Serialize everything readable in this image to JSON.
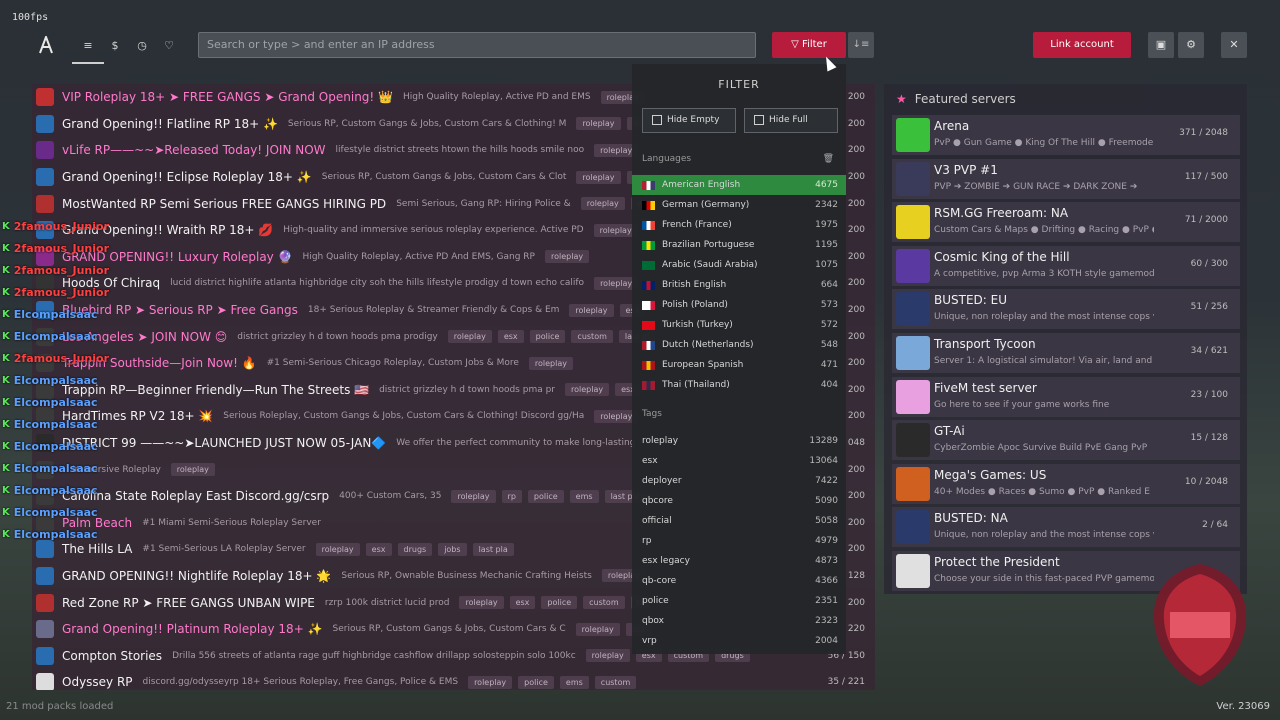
{
  "fps": "100fps",
  "topbar": {
    "search_placeholder": "Search or type > and enter an IP address",
    "filter_label": "Filter",
    "link_account_label": "Link account"
  },
  "servers": [
    {
      "name": "VIP Roleplay 18+ ➤ FREE GANGS ➤ Grand Opening! 👑",
      "pink": true,
      "desc": "High Quality Roleplay, Active PD and EMS",
      "tags": [
        "roleplay"
      ],
      "players": "200",
      "color": "#c03030"
    },
    {
      "name": "Grand Opening!! Flatline RP 18+ ✨",
      "pink": false,
      "desc": "Serious RP, Custom Gangs & Jobs, Custom Cars & Clothing! M",
      "tags": [
        "roleplay",
        "drugs"
      ],
      "players": "200",
      "color": "#2a6cb0"
    },
    {
      "name": "vLife RP——~~➤Released Today! JOIN NOW",
      "pink": true,
      "desc": "lifestyle district streets htown the hills hoods smile noo",
      "tags": [
        "roleplay"
      ],
      "players": "200",
      "color": "#6a2a8a"
    },
    {
      "name": "Grand Opening!! Eclipse Roleplay 18+ ✨",
      "pink": false,
      "desc": "Serious RP, Custom Gangs & Jobs, Custom Cars & Clot",
      "tags": [
        "roleplay",
        "drugs"
      ],
      "players": "200",
      "color": "#2a6cb0"
    },
    {
      "name": "MostWanted RP Semi Serious FREE GANGS HIRING PD",
      "pink": false,
      "desc": "Semi Serious, Gang RP: Hiring Police &",
      "tags": [
        "roleplay",
        "esx"
      ],
      "players": "200",
      "color": "#b03030"
    },
    {
      "name": "Grand Opening!! Wraith RP 18+ 💋",
      "pink": false,
      "desc": "High-quality and immersive serious roleplay experience. Active PD",
      "tags": [
        "roleplay"
      ],
      "players": "200",
      "color": "#2a6cb0"
    },
    {
      "name": "GRAND OPENING!! Luxury Roleplay 🔮",
      "pink": true,
      "desc": "High Quality Roleplay, Active PD And EMS, Gang RP",
      "tags": [
        "roleplay"
      ],
      "players": "200",
      "color": "#8a2a8a"
    },
    {
      "name": "Hoods Of Chiraq",
      "pink": false,
      "desc": "lucid district highlife atlanta highbridge city soh the hills lifestyle prodigy d town echo califo",
      "tags": [
        "roleplay"
      ],
      "players": "200",
      "color": "#333333"
    },
    {
      "name": "Bluebird RP ➤ Serious RP ➤ Free Gangs",
      "pink": true,
      "desc": "18+ Serious Roleplay & Streamer Friendly & Cops & Em",
      "tags": [
        "roleplay",
        "esx"
      ],
      "players": "200",
      "color": "#2a6cb0"
    },
    {
      "name": "Los Angeles ➤ JOIN NOW 😊",
      "pink": true,
      "desc": "district grizzley h d town hoods pma prodigy",
      "tags": [
        "roleplay",
        "esx",
        "police",
        "custom",
        "last pl"
      ],
      "players": "200",
      "color": "#3a3a3a"
    },
    {
      "name": "Trappin Southside—Join Now! 🔥",
      "pink": true,
      "desc": "#1 Semi-Serious Chicago Roleplay, Custom Jobs & More",
      "tags": [
        "roleplay"
      ],
      "players": "200",
      "color": "#3a3a3a"
    },
    {
      "name": "Trappin RP—Beginner Friendly—Run The Streets 🇺🇸",
      "pink": false,
      "desc": "district grizzley h d town hoods pma pr",
      "tags": [
        "roleplay",
        "esx"
      ],
      "players": "200",
      "color": "#3a3a3a"
    },
    {
      "name": "HardTimes RP V2 18+ 💥",
      "pink": false,
      "desc": "Serious Roleplay, Custom Gangs & Jobs, Custom Cars & Clothing! Discord gg/Ha",
      "tags": [
        "roleplay"
      ],
      "players": "200",
      "color": "#3a3a3a"
    },
    {
      "name": "DISTRICT 99 ——~~➤LAUNCHED JUST NOW 05-JAN🔷",
      "pink": false,
      "desc": "We offer the perfect community to make long-lasting",
      "tags": [],
      "players": "048",
      "color": "#2a2a2a"
    },
    {
      "name": "",
      "pink": false,
      "desc": "Immersive Roleplay",
      "tags": [
        "roleplay"
      ],
      "players": "200",
      "color": "#3a3a3a"
    },
    {
      "name": "Carolina State Roleplay East Discord.gg/csrp",
      "pink": false,
      "desc": "400+ Custom Cars, 35",
      "tags": [
        "roleplay",
        "rp",
        "police",
        "ems",
        "last player"
      ],
      "players": "200",
      "color": "#3a3a3a"
    },
    {
      "name": "Palm Beach",
      "pink": true,
      "desc": "#1 Miami Semi-Serious Roleplay Server",
      "tags": [],
      "players": "200",
      "color": "#3a3a3a"
    },
    {
      "name": "The Hills LA",
      "pink": false,
      "desc": "#1 Semi-Serious LA Roleplay Server",
      "tags": [
        "roleplay",
        "esx",
        "drugs",
        "jobs",
        "last pla"
      ],
      "players": "200",
      "color": "#2a6cb0"
    },
    {
      "name": "GRAND OPENING!! Nightlife Roleplay 18+ 🌟",
      "pink": false,
      "desc": "Serious RP, Ownable Business Mechanic Crafting Heists",
      "tags": [
        "roleplay"
      ],
      "players": "128",
      "color": "#2a6cb0"
    },
    {
      "name": "Red Zone RP ➤ FREE GANGS UNBAN WIPE",
      "pink": false,
      "desc": "rzrp 100k district lucid prod",
      "tags": [
        "roleplay",
        "esx",
        "police",
        "custom",
        "la"
      ],
      "players": "200",
      "color": "#b03030"
    },
    {
      "name": "Grand Opening!! Platinum Roleplay 18+ ✨",
      "pink": true,
      "desc": "Serious RP, Custom Gangs & Jobs, Custom Cars & C",
      "tags": [
        "roleplay",
        "esx"
      ],
      "players": "220",
      "color": "#6a6a8a"
    },
    {
      "name": "Compton Stories",
      "pink": false,
      "desc": "Drilla 556 streets of atlanta rage guff highbridge cashflow drillapp solosteppin solo 100kc",
      "tags": [
        "roleplay",
        "esx",
        "custom",
        "drugs"
      ],
      "players": "56 / 150",
      "color": "#2a6cb0"
    },
    {
      "name": "Odyssey RP",
      "pink": false,
      "desc": "discord.gg/odysseyrp 18+ Serious Roleplay, Free Gangs, Police & EMS",
      "tags": [
        "roleplay",
        "police",
        "ems",
        "custom"
      ],
      "players": "35 / 221",
      "color": "#dddddd"
    }
  ],
  "chat": [
    {
      "name": "2famous_Junior",
      "team": "red"
    },
    {
      "name": "2famous_Junior",
      "team": "red"
    },
    {
      "name": "2famous_Junior",
      "team": "red"
    },
    {
      "name": "2famous_Junior",
      "team": "red"
    },
    {
      "name": "Elcompalsaac",
      "team": "blue"
    },
    {
      "name": "Elcompalsaac",
      "team": "blue"
    },
    {
      "name": "2famous_Junior",
      "team": "red"
    },
    {
      "name": "Elcompalsaac",
      "team": "blue"
    },
    {
      "name": "Elcompalsaac",
      "team": "blue"
    },
    {
      "name": "Elcompalsaac",
      "team": "blue"
    },
    {
      "name": "Elcompalsaac",
      "team": "blue"
    },
    {
      "name": "Elcompalsaac",
      "team": "blue"
    },
    {
      "name": "Elcompalsaac",
      "team": "blue"
    },
    {
      "name": "Elcompalsaac",
      "team": "blue"
    },
    {
      "name": "Elcompalsaac",
      "team": "blue"
    }
  ],
  "filter": {
    "title": "FILTER",
    "hide_empty": "Hide Empty",
    "hide_full": "Hide Full",
    "languages_label": "Languages",
    "languages": [
      {
        "label": "American English",
        "count": "4675",
        "selected": true,
        "c1": "#b22234",
        "c2": "#ffffff",
        "c3": "#3c3b6e"
      },
      {
        "label": "German (Germany)",
        "count": "2342",
        "selected": false,
        "c1": "#000000",
        "c2": "#dd0000",
        "c3": "#ffce00"
      },
      {
        "label": "French (France)",
        "count": "1975",
        "selected": false,
        "c1": "#0055a4",
        "c2": "#ffffff",
        "c3": "#ef4135"
      },
      {
        "label": "Brazilian Portuguese",
        "count": "1195",
        "selected": false,
        "c1": "#009c3b",
        "c2": "#ffdf00",
        "c3": "#009c3b"
      },
      {
        "label": "Arabic (Saudi Arabia)",
        "count": "1075",
        "selected": false,
        "c1": "#006c35",
        "c2": "#006c35",
        "c3": "#006c35"
      },
      {
        "label": "British English",
        "count": "664",
        "selected": false,
        "c1": "#012169",
        "c2": "#c8102e",
        "c3": "#012169"
      },
      {
        "label": "Polish (Poland)",
        "count": "573",
        "selected": false,
        "c1": "#ffffff",
        "c2": "#ffffff",
        "c3": "#dc143c"
      },
      {
        "label": "Turkish (Turkey)",
        "count": "572",
        "selected": false,
        "c1": "#e30a17",
        "c2": "#e30a17",
        "c3": "#e30a17"
      },
      {
        "label": "Dutch (Netherlands)",
        "count": "548",
        "selected": false,
        "c1": "#ae1c28",
        "c2": "#ffffff",
        "c3": "#21468b"
      },
      {
        "label": "European Spanish",
        "count": "471",
        "selected": false,
        "c1": "#aa151b",
        "c2": "#f1bf00",
        "c3": "#aa151b"
      },
      {
        "label": "Thai (Thailand)",
        "count": "404",
        "selected": false,
        "c1": "#a51931",
        "c2": "#2d2a4a",
        "c3": "#a51931"
      }
    ],
    "tags_label": "Tags",
    "tags": [
      {
        "label": "roleplay",
        "count": "13289"
      },
      {
        "label": "esx",
        "count": "13064"
      },
      {
        "label": "deployer",
        "count": "7422"
      },
      {
        "label": "qbcore",
        "count": "5090"
      },
      {
        "label": "official",
        "count": "5058"
      },
      {
        "label": "rp",
        "count": "4979"
      },
      {
        "label": "esx legacy",
        "count": "4873"
      },
      {
        "label": "qb-core",
        "count": "4366"
      },
      {
        "label": "police",
        "count": "2351"
      },
      {
        "label": "qbox",
        "count": "2323"
      },
      {
        "label": "vrp",
        "count": "2004"
      }
    ]
  },
  "featured": {
    "title": "Featured servers",
    "items": [
      {
        "name": "Arena",
        "desc": "PvP ● Gun Game ● King Of The Hill ● Freemode",
        "count": "371 / 2048",
        "color": "#3ac03a"
      },
      {
        "name": "V3 PVP #1",
        "desc": "PVP ➔ ZOMBIE ➔ GUN RACE ➔ DARK ZONE ➔",
        "count": "117 / 500",
        "color": "#3a3a5a"
      },
      {
        "name": "RSM.GG Freeroam: NA",
        "desc": "Custom Cars & Maps ● Drifting ● Racing ● PvP ●",
        "count": "71 / 2000",
        "color": "#e8d020"
      },
      {
        "name": "Cosmic King of the Hill",
        "desc": "A competitive, pvp Arma 3 KOTH style gamemode",
        "count": "60 / 300",
        "color": "#5a3aa0"
      },
      {
        "name": "BUSTED: EU",
        "desc": "Unique, non roleplay and the most intense cops vs",
        "count": "51 / 256",
        "color": "#2a3a6a"
      },
      {
        "name": "Transport Tycoon",
        "desc": "Server 1: A logistical simulator! Via air, land and water",
        "count": "34 / 621",
        "color": "#7aa8d8"
      },
      {
        "name": "FiveM test server",
        "desc": "Go here to see if your game works fine",
        "count": "23 / 100",
        "color": "#e8a0e0"
      },
      {
        "name": "GT-Ai",
        "desc": "CyberZombie Apoc Survive Build PvE Gang PvP",
        "count": "15 / 128",
        "color": "#2a2a2a"
      },
      {
        "name": "Mega's Games: US",
        "desc": "40+ Modes ● Races ● Sumo ● PvP ● Ranked E",
        "count": "10 / 2048",
        "color": "#d06020"
      },
      {
        "name": "BUSTED: NA",
        "desc": "Unique, non roleplay and the most intense cops vs",
        "count": "2 / 64",
        "color": "#2a3a6a"
      },
      {
        "name": "Protect the President",
        "desc": "Choose your side in this fast-paced PVP gamemode",
        "count": "",
        "color": "#e0e0e0"
      }
    ]
  },
  "status": "21 mod packs loaded",
  "version": "Ver. 23069"
}
